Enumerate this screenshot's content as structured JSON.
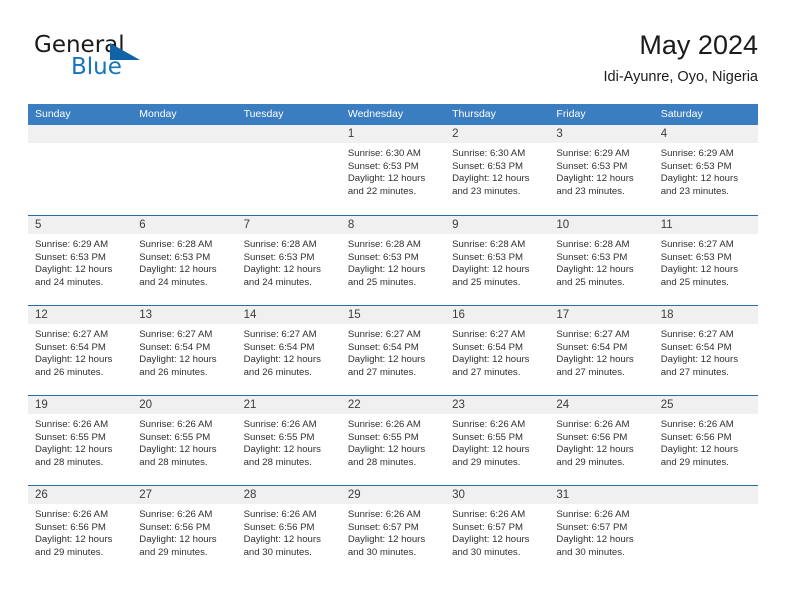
{
  "brand": {
    "name_part1": "General",
    "name_part2": "Blue",
    "accent_color": "#1576bc",
    "triangle_color": "#1162a6"
  },
  "header": {
    "title": "May 2024",
    "subtitle": "Idi-Ayunre, Oyo, Nigeria"
  },
  "theme": {
    "header_row_bg": "#3a7dc0",
    "row_separator": "#2b6ca8",
    "day_band_bg": "#f0f0f0"
  },
  "weekdays": [
    "Sunday",
    "Monday",
    "Tuesday",
    "Wednesday",
    "Thursday",
    "Friday",
    "Saturday"
  ],
  "weeks": [
    [
      {
        "day": "",
        "lines": []
      },
      {
        "day": "",
        "lines": []
      },
      {
        "day": "",
        "lines": []
      },
      {
        "day": "1",
        "lines": [
          "Sunrise: 6:30 AM",
          "Sunset: 6:53 PM",
          "Daylight: 12 hours",
          "and 22 minutes."
        ]
      },
      {
        "day": "2",
        "lines": [
          "Sunrise: 6:30 AM",
          "Sunset: 6:53 PM",
          "Daylight: 12 hours",
          "and 23 minutes."
        ]
      },
      {
        "day": "3",
        "lines": [
          "Sunrise: 6:29 AM",
          "Sunset: 6:53 PM",
          "Daylight: 12 hours",
          "and 23 minutes."
        ]
      },
      {
        "day": "4",
        "lines": [
          "Sunrise: 6:29 AM",
          "Sunset: 6:53 PM",
          "Daylight: 12 hours",
          "and 23 minutes."
        ]
      }
    ],
    [
      {
        "day": "5",
        "lines": [
          "Sunrise: 6:29 AM",
          "Sunset: 6:53 PM",
          "Daylight: 12 hours",
          "and 24 minutes."
        ]
      },
      {
        "day": "6",
        "lines": [
          "Sunrise: 6:28 AM",
          "Sunset: 6:53 PM",
          "Daylight: 12 hours",
          "and 24 minutes."
        ]
      },
      {
        "day": "7",
        "lines": [
          "Sunrise: 6:28 AM",
          "Sunset: 6:53 PM",
          "Daylight: 12 hours",
          "and 24 minutes."
        ]
      },
      {
        "day": "8",
        "lines": [
          "Sunrise: 6:28 AM",
          "Sunset: 6:53 PM",
          "Daylight: 12 hours",
          "and 25 minutes."
        ]
      },
      {
        "day": "9",
        "lines": [
          "Sunrise: 6:28 AM",
          "Sunset: 6:53 PM",
          "Daylight: 12 hours",
          "and 25 minutes."
        ]
      },
      {
        "day": "10",
        "lines": [
          "Sunrise: 6:28 AM",
          "Sunset: 6:53 PM",
          "Daylight: 12 hours",
          "and 25 minutes."
        ]
      },
      {
        "day": "11",
        "lines": [
          "Sunrise: 6:27 AM",
          "Sunset: 6:53 PM",
          "Daylight: 12 hours",
          "and 25 minutes."
        ]
      }
    ],
    [
      {
        "day": "12",
        "lines": [
          "Sunrise: 6:27 AM",
          "Sunset: 6:54 PM",
          "Daylight: 12 hours",
          "and 26 minutes."
        ]
      },
      {
        "day": "13",
        "lines": [
          "Sunrise: 6:27 AM",
          "Sunset: 6:54 PM",
          "Daylight: 12 hours",
          "and 26 minutes."
        ]
      },
      {
        "day": "14",
        "lines": [
          "Sunrise: 6:27 AM",
          "Sunset: 6:54 PM",
          "Daylight: 12 hours",
          "and 26 minutes."
        ]
      },
      {
        "day": "15",
        "lines": [
          "Sunrise: 6:27 AM",
          "Sunset: 6:54 PM",
          "Daylight: 12 hours",
          "and 27 minutes."
        ]
      },
      {
        "day": "16",
        "lines": [
          "Sunrise: 6:27 AM",
          "Sunset: 6:54 PM",
          "Daylight: 12 hours",
          "and 27 minutes."
        ]
      },
      {
        "day": "17",
        "lines": [
          "Sunrise: 6:27 AM",
          "Sunset: 6:54 PM",
          "Daylight: 12 hours",
          "and 27 minutes."
        ]
      },
      {
        "day": "18",
        "lines": [
          "Sunrise: 6:27 AM",
          "Sunset: 6:54 PM",
          "Daylight: 12 hours",
          "and 27 minutes."
        ]
      }
    ],
    [
      {
        "day": "19",
        "lines": [
          "Sunrise: 6:26 AM",
          "Sunset: 6:55 PM",
          "Daylight: 12 hours",
          "and 28 minutes."
        ]
      },
      {
        "day": "20",
        "lines": [
          "Sunrise: 6:26 AM",
          "Sunset: 6:55 PM",
          "Daylight: 12 hours",
          "and 28 minutes."
        ]
      },
      {
        "day": "21",
        "lines": [
          "Sunrise: 6:26 AM",
          "Sunset: 6:55 PM",
          "Daylight: 12 hours",
          "and 28 minutes."
        ]
      },
      {
        "day": "22",
        "lines": [
          "Sunrise: 6:26 AM",
          "Sunset: 6:55 PM",
          "Daylight: 12 hours",
          "and 28 minutes."
        ]
      },
      {
        "day": "23",
        "lines": [
          "Sunrise: 6:26 AM",
          "Sunset: 6:55 PM",
          "Daylight: 12 hours",
          "and 29 minutes."
        ]
      },
      {
        "day": "24",
        "lines": [
          "Sunrise: 6:26 AM",
          "Sunset: 6:56 PM",
          "Daylight: 12 hours",
          "and 29 minutes."
        ]
      },
      {
        "day": "25",
        "lines": [
          "Sunrise: 6:26 AM",
          "Sunset: 6:56 PM",
          "Daylight: 12 hours",
          "and 29 minutes."
        ]
      }
    ],
    [
      {
        "day": "26",
        "lines": [
          "Sunrise: 6:26 AM",
          "Sunset: 6:56 PM",
          "Daylight: 12 hours",
          "and 29 minutes."
        ]
      },
      {
        "day": "27",
        "lines": [
          "Sunrise: 6:26 AM",
          "Sunset: 6:56 PM",
          "Daylight: 12 hours",
          "and 29 minutes."
        ]
      },
      {
        "day": "28",
        "lines": [
          "Sunrise: 6:26 AM",
          "Sunset: 6:56 PM",
          "Daylight: 12 hours",
          "and 30 minutes."
        ]
      },
      {
        "day": "29",
        "lines": [
          "Sunrise: 6:26 AM",
          "Sunset: 6:57 PM",
          "Daylight: 12 hours",
          "and 30 minutes."
        ]
      },
      {
        "day": "30",
        "lines": [
          "Sunrise: 6:26 AM",
          "Sunset: 6:57 PM",
          "Daylight: 12 hours",
          "and 30 minutes."
        ]
      },
      {
        "day": "31",
        "lines": [
          "Sunrise: 6:26 AM",
          "Sunset: 6:57 PM",
          "Daylight: 12 hours",
          "and 30 minutes."
        ]
      },
      {
        "day": "",
        "lines": []
      }
    ]
  ]
}
